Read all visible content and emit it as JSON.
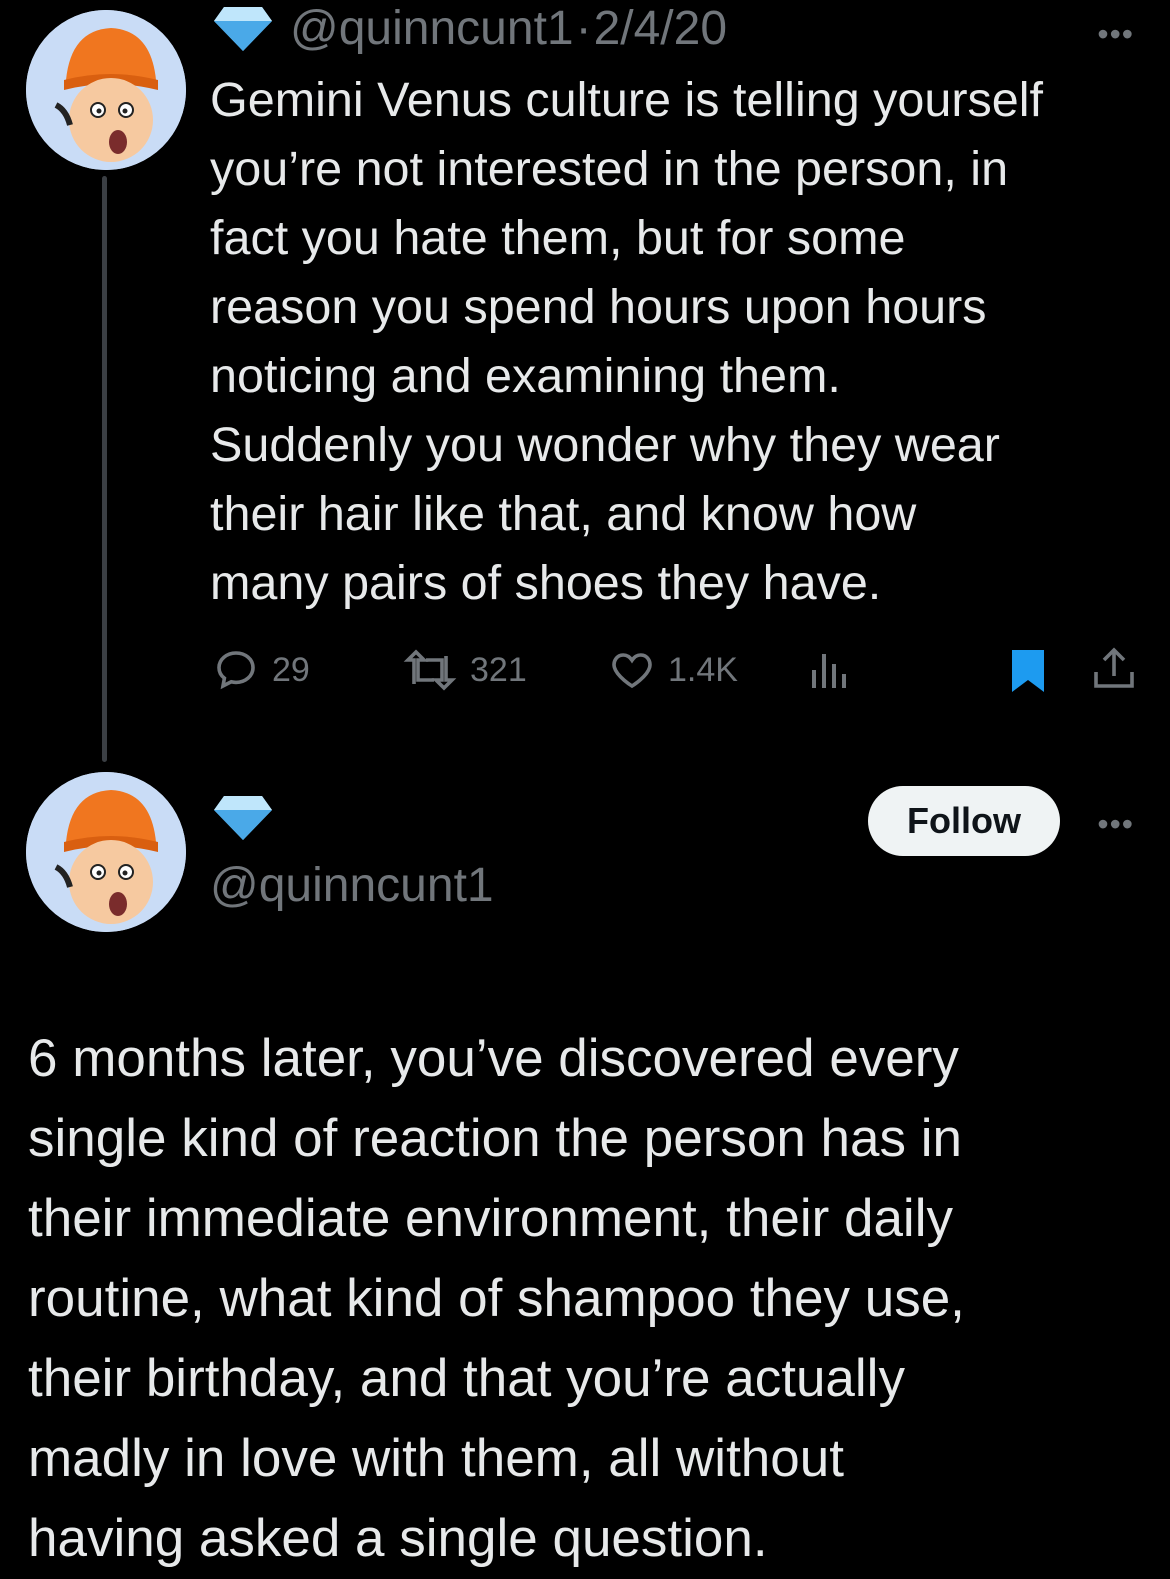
{
  "tweet1": {
    "handle": "@quinncunt1",
    "separator": "·",
    "date": "2/4/20",
    "more_label": "•••",
    "text": "Gemini Venus culture is telling yourself\nyou’re not interested in the person, in\nfact you hate them, but for some\nreason you spend hours upon hours\nnoticing and examining them.\nSuddenly you wonder why they wear\ntheir hair like that, and know how\nmany pairs of shoes they have.",
    "replies": "29",
    "retweets": "321",
    "likes": "1.4K",
    "icons": [
      "reply-icon",
      "retweet-icon",
      "like-icon",
      "views-icon",
      "bookmark-icon",
      "share-icon"
    ],
    "bookmark_color": "#1d9bf0"
  },
  "tweet2": {
    "handle": "@quinncunt1",
    "follow_label": "Follow",
    "more_label": "•••",
    "text": "6 months later, you’ve discovered every\nsingle kind of reaction the person has in\ntheir immediate environment, their daily\nroutine, what kind of shampoo they use,\ntheir birthday, and that you’re actually\nmadly in love with them, all without\nhaving asked a single question."
  },
  "colors": {
    "background": "#000000",
    "text": "#e7e9ea",
    "muted": "#71767b",
    "accent": "#1d9bf0",
    "avatar_bg": "#c9dcf6",
    "hat": "#f0761f"
  }
}
